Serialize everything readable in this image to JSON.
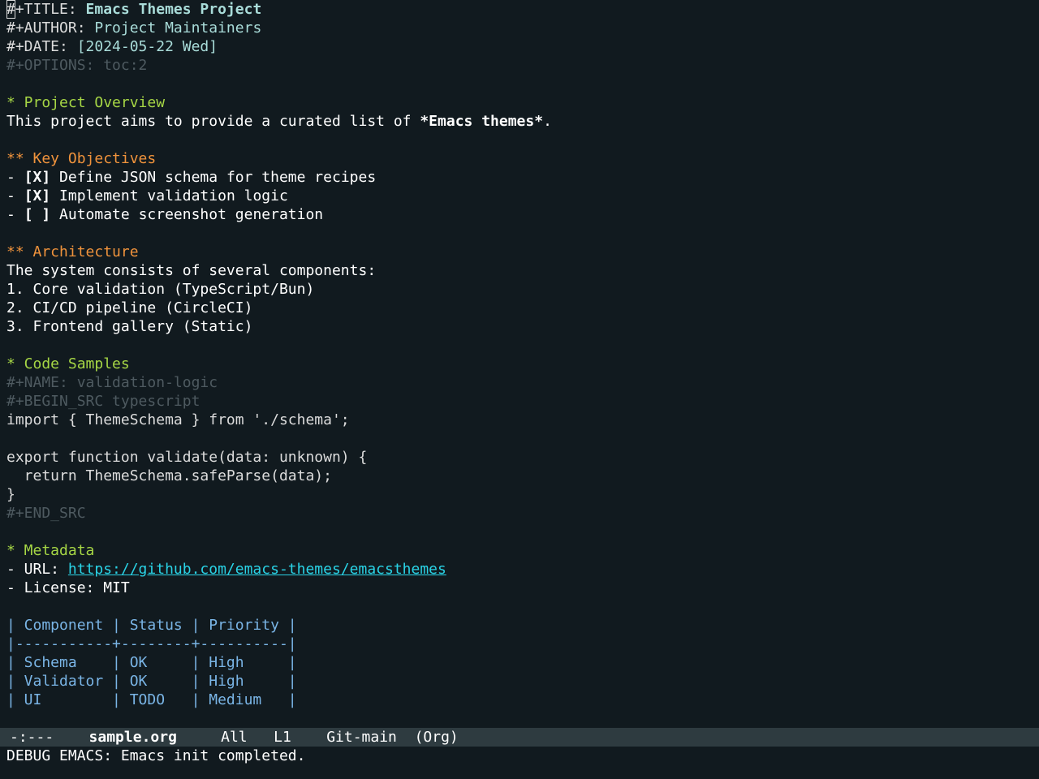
{
  "buffer": {
    "title_kw": "#+TITLE: ",
    "title_first_char": "#",
    "title_kw_rest": "+TITLE: ",
    "title_val": "Emacs Themes Project",
    "author_kw": "#+AUTHOR: ",
    "author_val": "Project Maintainers",
    "date_kw": "#+DATE: ",
    "date_val": "[2024-05-22 Wed]",
    "options_line": "#+OPTIONS: toc:2",
    "h1_overview": "* Project Overview",
    "overview_text_pre": "This project aims to provide a curated list of ",
    "overview_text_bold": "*Emacs themes*",
    "overview_text_post": ".",
    "h2_objectives": "** Key Objectives",
    "objectives": [
      {
        "prefix": "- ",
        "checkbox": "[X]",
        "text": " Define JSON schema for theme recipes"
      },
      {
        "prefix": "- ",
        "checkbox": "[X]",
        "text": " Implement validation logic"
      },
      {
        "prefix": "- ",
        "checkbox": "[ ]",
        "text": " Automate screenshot generation"
      }
    ],
    "h2_architecture": "** Architecture",
    "architecture_intro": "The system consists of several components:",
    "architecture_items": [
      "1. Core validation (TypeScript/Bun)",
      "2. CI/CD pipeline (CircleCI)",
      "3. Frontend gallery (Static)"
    ],
    "h1_code": "* Code Samples",
    "code_name": "#+NAME: validation-logic",
    "code_begin": "#+BEGIN_SRC typescript",
    "code_lines": [
      "import { ThemeSchema } from './schema';",
      "",
      "export function validate(data: unknown) {",
      "  return ThemeSchema.safeParse(data);",
      "}"
    ],
    "code_end": "#+END_SRC",
    "h1_metadata": "* Metadata",
    "url_prefix": "- URL: ",
    "url": "https://github.com/emacs-themes/emacsthemes",
    "license_line": "- License: MIT",
    "table_lines": [
      "| Component | Status | Priority |",
      "|-----------+--------+----------|",
      "| Schema    | OK     | High     |",
      "| Validator | OK     | High     |",
      "| UI        | TODO   | Medium   |"
    ]
  },
  "modeline": {
    "status": "-:---",
    "buffer_name": "sample.org",
    "position": "All",
    "line": "L1",
    "vc": "Git-main",
    "mode": "(Org)"
  },
  "echo_area": {
    "message": "DEBUG EMACS: Emacs init completed."
  },
  "colors": {
    "background": "#111a1f",
    "heading_level1": "#a6d645",
    "heading_level2": "#f0933c",
    "meta_value": "#a9dcd9",
    "dimmed": "#4e5a60",
    "link": "#2ad3e6",
    "table": "#7ab5e6",
    "modeline_bg": "#2e3b40"
  }
}
